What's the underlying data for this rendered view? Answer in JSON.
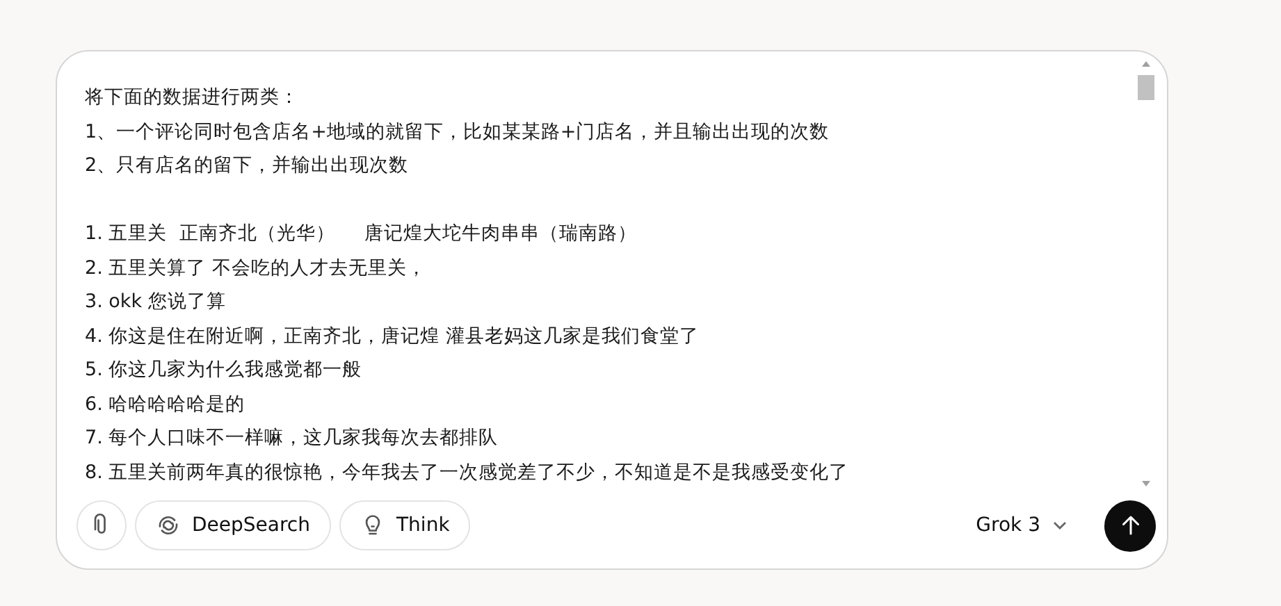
{
  "composer": {
    "instructions": [
      "将下面的数据进行两类：",
      "1、一个评论同时包含店名+地域的就留下，比如某某路+门店名，并且输出出现的次数",
      "2、只有店名的留下，并输出出现次数"
    ],
    "comments": [
      "1. 五里关  正南齐北（光华）     唐记煌大坨牛肉串串（瑞南路）",
      "2. 五里关算了 不会吃的人才去无里关，",
      "3. okk 您说了算",
      "4. 你这是住在附近啊，正南齐北，唐记煌 灌县老妈这几家是我们食堂了",
      "5. 你这几家为什么我感觉都一般",
      "6. 哈哈哈哈哈是的",
      "7. 每个人口味不一样嘛，这几家我每次去都排队",
      "8. 五里关前两年真的很惊艳，今年我去了一次感觉差了不少，不知道是不是我感受变化了"
    ]
  },
  "toolbar": {
    "buttons": [
      {
        "kind": "deepsearch",
        "label": "DeepSearch",
        "selected": false
      },
      {
        "kind": "think",
        "label": "Think",
        "selected": false
      }
    ],
    "model": "Grok 3"
  }
}
